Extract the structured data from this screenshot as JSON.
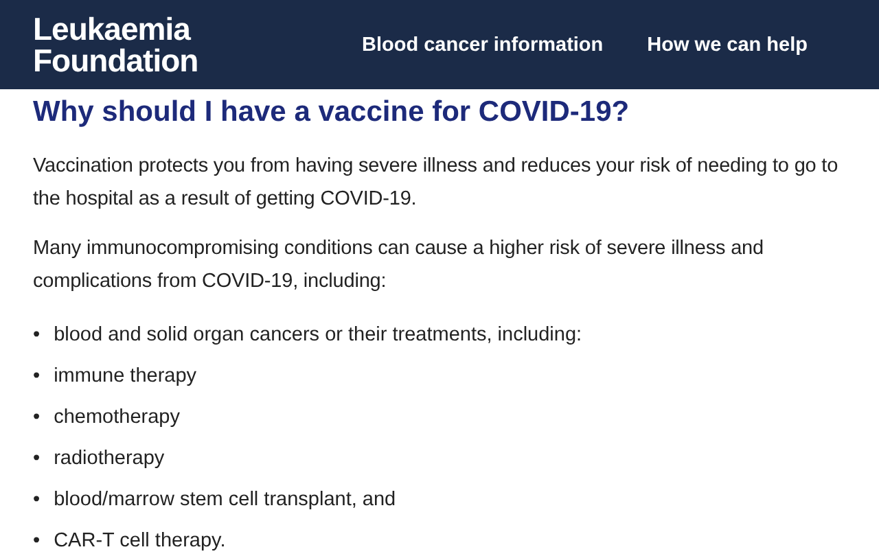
{
  "header": {
    "logo": [
      "Leukaemia",
      "Foundation"
    ],
    "nav": [
      "Blood cancer information",
      "How we can help"
    ]
  },
  "heading": "Why should I have a vaccine for COVID-19?",
  "paragraphs": [
    "Vaccination protects you from having severe illness and reduces your risk of needing to go to the hospital as a result of getting COVID-19.",
    "Many immunocompromising conditions can cause a higher risk of severe illness and complications from COVID-19, including:"
  ],
  "bullets": [
    {
      "marker": "•",
      "text": "blood and solid organ cancers or their treatments, including:"
    },
    {
      "marker": "•",
      "text": "immune therapy"
    },
    {
      "marker": "•",
      "text": "chemotherapy"
    },
    {
      "marker": "•",
      "text": "radiotherapy"
    },
    {
      "marker": "•",
      "text": "blood/marrow stem cell transplant, and"
    },
    {
      "marker": "•",
      "text": "CAR-T cell therapy."
    }
  ]
}
